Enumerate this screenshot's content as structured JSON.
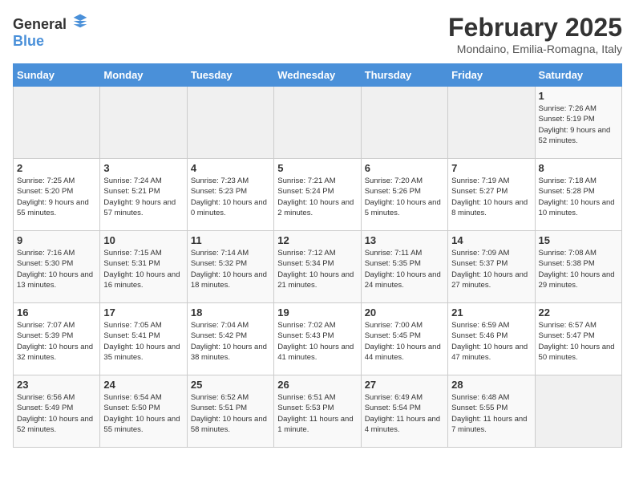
{
  "header": {
    "logo_general": "General",
    "logo_blue": "Blue",
    "title": "February 2025",
    "subtitle": "Mondaino, Emilia-Romagna, Italy"
  },
  "days_of_week": [
    "Sunday",
    "Monday",
    "Tuesday",
    "Wednesday",
    "Thursday",
    "Friday",
    "Saturday"
  ],
  "weeks": [
    [
      {
        "day": "",
        "info": ""
      },
      {
        "day": "",
        "info": ""
      },
      {
        "day": "",
        "info": ""
      },
      {
        "day": "",
        "info": ""
      },
      {
        "day": "",
        "info": ""
      },
      {
        "day": "",
        "info": ""
      },
      {
        "day": "1",
        "info": "Sunrise: 7:26 AM\nSunset: 5:19 PM\nDaylight: 9 hours and 52 minutes."
      }
    ],
    [
      {
        "day": "2",
        "info": "Sunrise: 7:25 AM\nSunset: 5:20 PM\nDaylight: 9 hours and 55 minutes."
      },
      {
        "day": "3",
        "info": "Sunrise: 7:24 AM\nSunset: 5:21 PM\nDaylight: 9 hours and 57 minutes."
      },
      {
        "day": "4",
        "info": "Sunrise: 7:23 AM\nSunset: 5:23 PM\nDaylight: 10 hours and 0 minutes."
      },
      {
        "day": "5",
        "info": "Sunrise: 7:21 AM\nSunset: 5:24 PM\nDaylight: 10 hours and 2 minutes."
      },
      {
        "day": "6",
        "info": "Sunrise: 7:20 AM\nSunset: 5:26 PM\nDaylight: 10 hours and 5 minutes."
      },
      {
        "day": "7",
        "info": "Sunrise: 7:19 AM\nSunset: 5:27 PM\nDaylight: 10 hours and 8 minutes."
      },
      {
        "day": "8",
        "info": "Sunrise: 7:18 AM\nSunset: 5:28 PM\nDaylight: 10 hours and 10 minutes."
      }
    ],
    [
      {
        "day": "9",
        "info": "Sunrise: 7:16 AM\nSunset: 5:30 PM\nDaylight: 10 hours and 13 minutes."
      },
      {
        "day": "10",
        "info": "Sunrise: 7:15 AM\nSunset: 5:31 PM\nDaylight: 10 hours and 16 minutes."
      },
      {
        "day": "11",
        "info": "Sunrise: 7:14 AM\nSunset: 5:32 PM\nDaylight: 10 hours and 18 minutes."
      },
      {
        "day": "12",
        "info": "Sunrise: 7:12 AM\nSunset: 5:34 PM\nDaylight: 10 hours and 21 minutes."
      },
      {
        "day": "13",
        "info": "Sunrise: 7:11 AM\nSunset: 5:35 PM\nDaylight: 10 hours and 24 minutes."
      },
      {
        "day": "14",
        "info": "Sunrise: 7:09 AM\nSunset: 5:37 PM\nDaylight: 10 hours and 27 minutes."
      },
      {
        "day": "15",
        "info": "Sunrise: 7:08 AM\nSunset: 5:38 PM\nDaylight: 10 hours and 29 minutes."
      }
    ],
    [
      {
        "day": "16",
        "info": "Sunrise: 7:07 AM\nSunset: 5:39 PM\nDaylight: 10 hours and 32 minutes."
      },
      {
        "day": "17",
        "info": "Sunrise: 7:05 AM\nSunset: 5:41 PM\nDaylight: 10 hours and 35 minutes."
      },
      {
        "day": "18",
        "info": "Sunrise: 7:04 AM\nSunset: 5:42 PM\nDaylight: 10 hours and 38 minutes."
      },
      {
        "day": "19",
        "info": "Sunrise: 7:02 AM\nSunset: 5:43 PM\nDaylight: 10 hours and 41 minutes."
      },
      {
        "day": "20",
        "info": "Sunrise: 7:00 AM\nSunset: 5:45 PM\nDaylight: 10 hours and 44 minutes."
      },
      {
        "day": "21",
        "info": "Sunrise: 6:59 AM\nSunset: 5:46 PM\nDaylight: 10 hours and 47 minutes."
      },
      {
        "day": "22",
        "info": "Sunrise: 6:57 AM\nSunset: 5:47 PM\nDaylight: 10 hours and 50 minutes."
      }
    ],
    [
      {
        "day": "23",
        "info": "Sunrise: 6:56 AM\nSunset: 5:49 PM\nDaylight: 10 hours and 52 minutes."
      },
      {
        "day": "24",
        "info": "Sunrise: 6:54 AM\nSunset: 5:50 PM\nDaylight: 10 hours and 55 minutes."
      },
      {
        "day": "25",
        "info": "Sunrise: 6:52 AM\nSunset: 5:51 PM\nDaylight: 10 hours and 58 minutes."
      },
      {
        "day": "26",
        "info": "Sunrise: 6:51 AM\nSunset: 5:53 PM\nDaylight: 11 hours and 1 minute."
      },
      {
        "day": "27",
        "info": "Sunrise: 6:49 AM\nSunset: 5:54 PM\nDaylight: 11 hours and 4 minutes."
      },
      {
        "day": "28",
        "info": "Sunrise: 6:48 AM\nSunset: 5:55 PM\nDaylight: 11 hours and 7 minutes."
      },
      {
        "day": "",
        "info": ""
      }
    ]
  ]
}
